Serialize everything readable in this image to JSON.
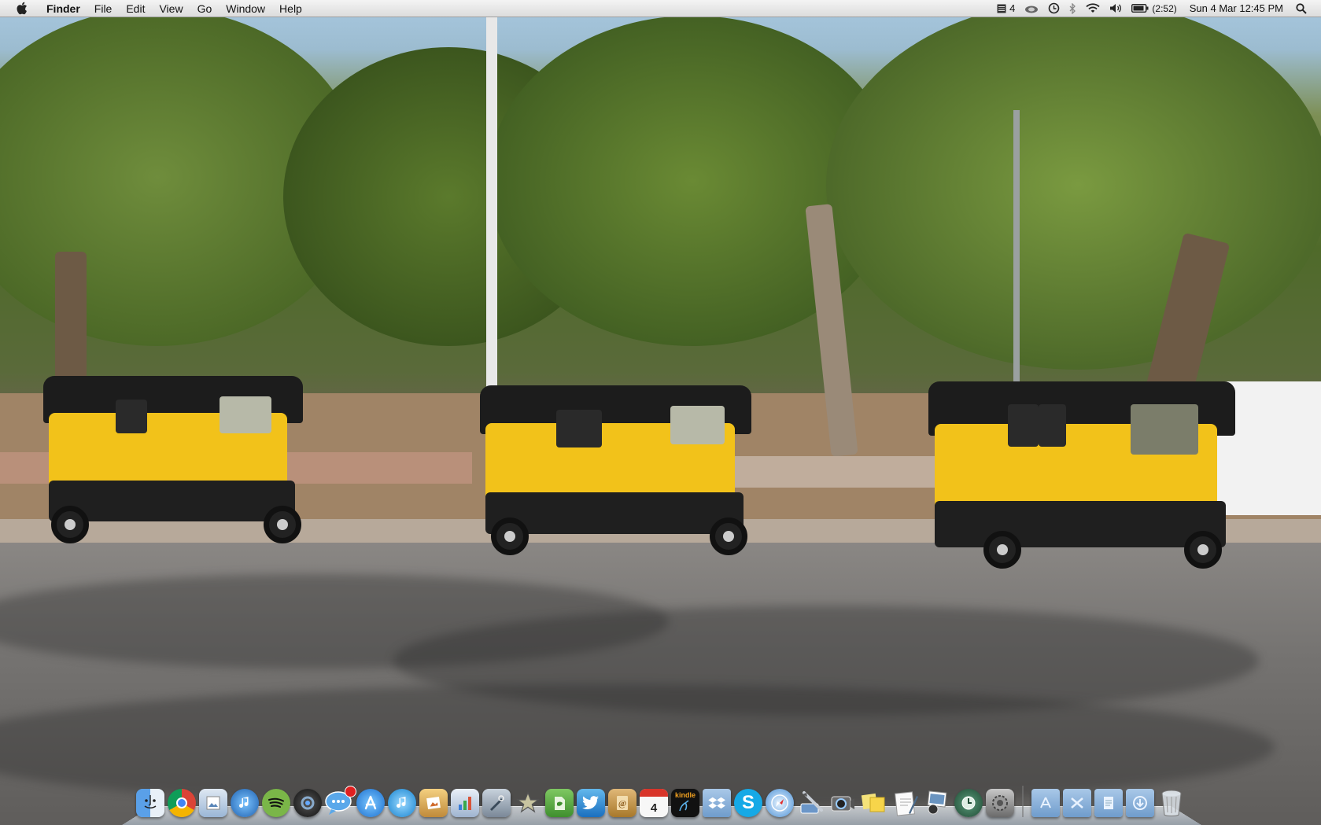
{
  "menubar": {
    "app_name": "Finder",
    "menus": [
      "File",
      "Edit",
      "View",
      "Go",
      "Window",
      "Help"
    ],
    "status": {
      "notification_count": "4",
      "battery_time": "(2:52)",
      "datetime": "Sun 4 Mar  12:45 PM"
    }
  },
  "dock": {
    "calendar_day": "4",
    "kindle_label": "kindle",
    "apps": [
      {
        "name": "Finder",
        "icon": "finder-icon",
        "color": "#4a8fd6"
      },
      {
        "name": "Google Chrome",
        "icon": "chrome-icon",
        "color": "#e33b2e"
      },
      {
        "name": "Preview",
        "icon": "preview-icon",
        "color": "#6aa0d0"
      },
      {
        "name": "iTunes",
        "icon": "itunes-icon",
        "color": "#2c7fd8"
      },
      {
        "name": "Spotify",
        "icon": "spotify-icon",
        "color": "#7ab648"
      },
      {
        "name": "Aperture",
        "icon": "aperture-icon",
        "color": "#333333"
      },
      {
        "name": "iChat",
        "icon": "ichat-icon",
        "color": "#3f8fe0"
      },
      {
        "name": "App Store",
        "icon": "app-store-icon",
        "color": "#2a87de"
      },
      {
        "name": "iTunes Store",
        "icon": "itunes-store-icon",
        "color": "#1f9be0"
      },
      {
        "name": "Photo Booth",
        "icon": "photo-app-icon",
        "color": "#d8a040"
      },
      {
        "name": "Grapher",
        "icon": "chart-icon",
        "color": "#5a7fb8"
      },
      {
        "name": "Script Editor",
        "icon": "pen-icon",
        "color": "#7a8898"
      },
      {
        "name": "Reeder",
        "icon": "star-icon",
        "color": "#8a8f6e"
      },
      {
        "name": "Evernote",
        "icon": "evernote-icon",
        "color": "#5fb04a"
      },
      {
        "name": "Twitter",
        "icon": "twitter-icon",
        "color": "#2a88d8"
      },
      {
        "name": "Address Book",
        "icon": "address-book-icon",
        "color": "#c99a52"
      },
      {
        "name": "iCal",
        "icon": "calendar-icon",
        "color": "#f4f4f4"
      },
      {
        "name": "Kindle",
        "icon": "kindle-icon",
        "color": "#111111"
      },
      {
        "name": "Dropbox",
        "icon": "dropbox-icon",
        "color": "#3d7dca"
      },
      {
        "name": "Skype",
        "icon": "skype-icon",
        "color": "#16a9e6"
      },
      {
        "name": "Safari",
        "icon": "safari-icon",
        "color": "#3c8fd6"
      },
      {
        "name": "Xcode",
        "icon": "xcode-icon",
        "color": "#7ba0c8"
      },
      {
        "name": "Image Capture",
        "icon": "camera-icon",
        "color": "#5a5a5a"
      },
      {
        "name": "Stickies",
        "icon": "stickies-icon",
        "color": "#f3d34a"
      },
      {
        "name": "TextEdit",
        "icon": "textedit-icon",
        "color": "#e8e8e8"
      },
      {
        "name": "iPhoto",
        "icon": "iphoto-icon",
        "color": "#6a94c0"
      },
      {
        "name": "Time Machine",
        "icon": "time-machine-icon",
        "color": "#2f6a4a"
      },
      {
        "name": "System Preferences",
        "icon": "settings-icon",
        "color": "#8a8a8a"
      }
    ],
    "stacks": [
      {
        "name": "Applications",
        "icon": "applications-folder-icon"
      },
      {
        "name": "Utilities",
        "icon": "utilities-folder-icon"
      },
      {
        "name": "Documents",
        "icon": "documents-folder-icon"
      },
      {
        "name": "Downloads",
        "icon": "downloads-folder-icon"
      }
    ],
    "trash": {
      "name": "Trash",
      "icon": "trash-icon"
    }
  }
}
